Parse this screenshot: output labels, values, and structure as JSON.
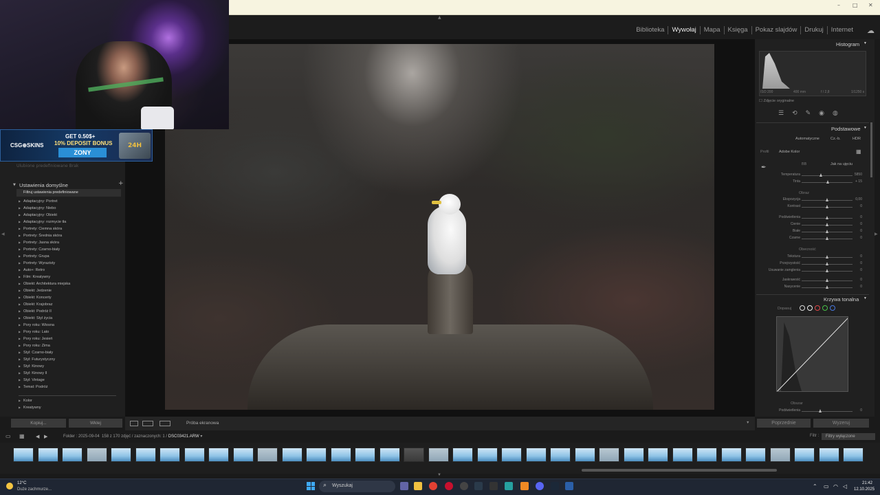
{
  "window": {
    "minimize": "–",
    "maximize": "□",
    "close": "✕"
  },
  "modules": [
    "Biblioteka",
    "Wywołaj",
    "Mapa",
    "Księga",
    "Pokaz slajdów",
    "Drukuj",
    "Internet"
  ],
  "active_module": "Wywołaj",
  "banner": {
    "brand": "CSG⊕SKINS",
    "line1": "GET 0.50$+",
    "line2": "10% DEPOSIT BONUS",
    "code": "ZONY",
    "box": "24H"
  },
  "left_panel": {
    "faded_row": "Ulubione predefiniowane   Brak",
    "section_title": "Ustawienia domyślne",
    "filter_label": "Filtruj ustawienia predefiniowane",
    "presets": [
      "Adaptacyjny: Portret",
      "Adaptacyjny: Niebo",
      "Adaptacyjny: Obiekt",
      "Adaptacyjny: rozmycie tła",
      "Portrety: Ciemna skóra",
      "Portrety: Średnia skóra",
      "Portrety: Jasna skóra",
      "Portrety: Czarno-biały",
      "Portrety: Grupa",
      "Portrety: Wyrazisty",
      "Auto+: Retro",
      "Film: Kreatywny",
      "Obiekt: Architektura miejska",
      "Obiekt: Jedzenie",
      "Obiekt: Koncerty",
      "Obiekt: Krajobraz",
      "Obiekt: Podróż II",
      "Obiekt: Styl życia",
      "Pory roku: Wiosna",
      "Pory roku: Lato",
      "Pory roku: Jesień",
      "Pory roku: Zima",
      "Styl: Czarno-biały",
      "Styl: Futurystyczny",
      "Styl: Kinowy",
      "Styl: Kinowy II",
      "Styl: Vintage",
      "Temat: Podróż"
    ],
    "presets2": [
      "Kolor",
      "Kreatywny"
    ],
    "copy_btn": "Kopiuj...",
    "paste_btn": "Wklej"
  },
  "right_panel": {
    "histogram_title": "Histogram",
    "histo_meta": [
      "ISO 200",
      "400 mm",
      "f / 2,8",
      "1/1250 s"
    ],
    "original_photo": "Zdjęcie oryginalne",
    "basic_title": "Podstawowe",
    "treatment": [
      "Automatyczne",
      "Cz.-b.",
      "HDR"
    ],
    "profile_label": "Profil",
    "profile_value": "Adobe Kolor",
    "wb_label": "BB",
    "wb_value": "Jak na ujęciu",
    "sliders_wb": [
      {
        "label": "Temperatura",
        "value": "5850",
        "pos": 0.38
      },
      {
        "label": "Tinta",
        "value": "+ 15",
        "pos": 0.52
      }
    ],
    "tone_title": "Obraz",
    "sliders_tone1": [
      {
        "label": "Ekspozycja",
        "value": "0,00",
        "pos": 0.5
      },
      {
        "label": "Kontrast",
        "value": "0",
        "pos": 0.5
      }
    ],
    "sliders_tone2": [
      {
        "label": "Podświetlenia",
        "value": "0",
        "pos": 0.5
      },
      {
        "label": "Cienie",
        "value": "0",
        "pos": 0.5
      },
      {
        "label": "Białe",
        "value": "0",
        "pos": 0.5
      },
      {
        "label": "Czarne",
        "value": "0",
        "pos": 0.5
      }
    ],
    "presence_title": "Obecność",
    "sliders_presence1": [
      {
        "label": "Tekstura",
        "value": "0",
        "pos": 0.5
      },
      {
        "label": "Przejrzystość",
        "value": "0",
        "pos": 0.5
      },
      {
        "label": "Usuwanie zamglenia",
        "value": "0",
        "pos": 0.5
      }
    ],
    "sliders_presence2": [
      {
        "label": "Jaskrawość",
        "value": "0",
        "pos": 0.5
      },
      {
        "label": "Nasycenie",
        "value": "0",
        "pos": 0.5
      }
    ],
    "curve_title": "Krzywa tonalna",
    "curve_adjust": "Dopasuj",
    "curve_region": "Obszar",
    "curve_slider": {
      "label": "Podświetlenia",
      "value": "0"
    },
    "prev_btn": "Poprzednie",
    "reset_btn": "Wyzeruj"
  },
  "toolbar": {
    "proof_label": "Próba ekranowa"
  },
  "filmstrip": {
    "info_prefix": "Folder : 2025-09-04",
    "info_count": "158 z 170 zdjęć / zaznaczonych: 1 /",
    "info_file": "DSC03421.ARW",
    "filter_label": "Filtr :",
    "filter_value": "Filtry wyłączone"
  },
  "taskbar": {
    "temp": "12°C",
    "weather": "Duże zachmurze...",
    "search": "Wyszukaj",
    "time": "21:42",
    "date": "12.10.2025"
  }
}
